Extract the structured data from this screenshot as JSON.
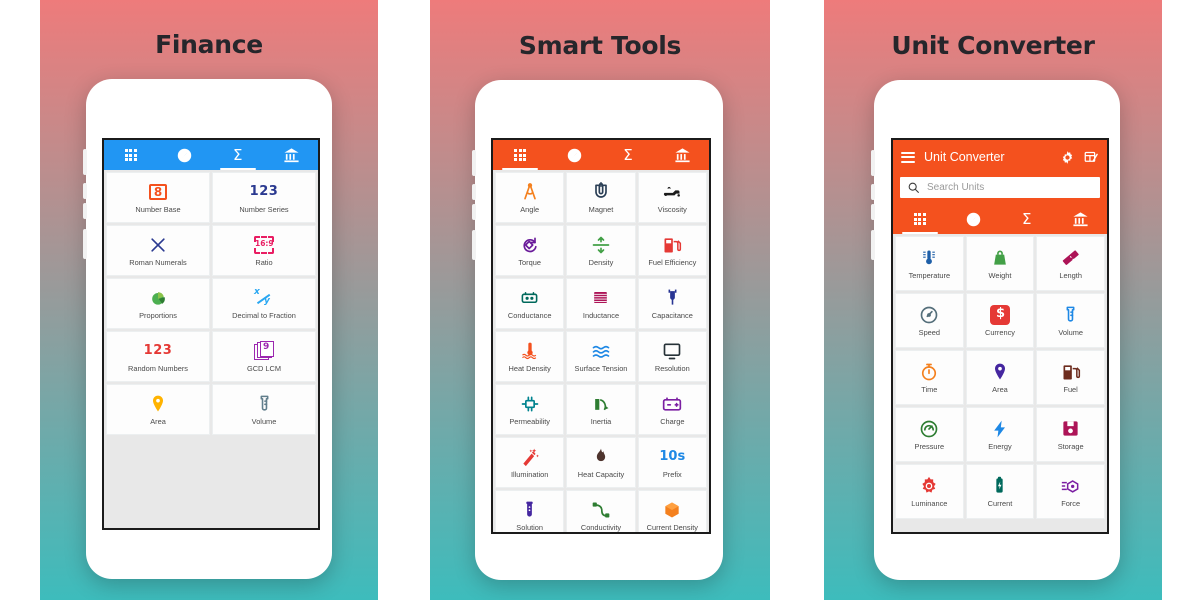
{
  "panels": [
    {
      "id": "finance",
      "title": "Finance",
      "accent": "#2196f3",
      "gradient_top": "#ee7b7b",
      "gradient_bottom": "#3dbcbc",
      "has_appbar": false,
      "has_search": false,
      "tabs": [
        {
          "icon": "grid-icon",
          "active": false
        },
        {
          "icon": "compass-icon",
          "active": false
        },
        {
          "icon": "sigma-icon",
          "active": true
        },
        {
          "icon": "bank-icon",
          "active": false
        }
      ],
      "grid_columns": 2,
      "items": [
        {
          "label": "Number Base",
          "icon": "number-base-icon",
          "color": "#f4511e"
        },
        {
          "label": "Number Series",
          "icon": "number-series-icon",
          "color": "#2a3990"
        },
        {
          "label": "Roman Numerals",
          "icon": "roman-numerals-icon",
          "color": "#2a3990"
        },
        {
          "label": "Ratio",
          "icon": "ratio-icon",
          "color": "#e91e63"
        },
        {
          "label": "Proportions",
          "icon": "proportions-icon",
          "color": "#4caf50"
        },
        {
          "label": "Decimal to Fraction",
          "icon": "decimal-fraction-icon",
          "color": "#29a7f2"
        },
        {
          "label": "Random Numbers",
          "icon": "random-numbers-icon",
          "color": "#e53935"
        },
        {
          "label": "GCD LCM",
          "icon": "gcd-lcm-icon",
          "color": "#9c27b0"
        },
        {
          "label": "Area",
          "icon": "area-pin-icon",
          "color": "#ffb300"
        },
        {
          "label": "Volume",
          "icon": "volume-beaker-icon",
          "color": "#607d8b"
        }
      ]
    },
    {
      "id": "smart-tools",
      "title": "Smart Tools",
      "accent": "#f4511e",
      "gradient_top": "#ee7b7b",
      "gradient_bottom": "#3dbcbc",
      "has_appbar": false,
      "has_search": false,
      "tabs": [
        {
          "icon": "grid-icon",
          "active": true
        },
        {
          "icon": "compass-icon",
          "active": false
        },
        {
          "icon": "sigma-icon",
          "active": false
        },
        {
          "icon": "bank-icon",
          "active": false
        }
      ],
      "grid_columns": 3,
      "items": [
        {
          "label": "Angle",
          "icon": "angle-compass-icon",
          "color": "#f4801e"
        },
        {
          "label": "Magnet",
          "icon": "magnet-icon",
          "color": "#2a3e55"
        },
        {
          "label": "Viscosity",
          "icon": "viscosity-icon",
          "color": "#1b1b1b"
        },
        {
          "label": "Torque",
          "icon": "torque-icon",
          "color": "#6a1b9a"
        },
        {
          "label": "Density",
          "icon": "density-icon",
          "color": "#43a047"
        },
        {
          "label": "Fuel Efficiency",
          "icon": "fuel-pump-icon",
          "color": "#e53935"
        },
        {
          "label": "Conductance",
          "icon": "conductance-icon",
          "color": "#00695c"
        },
        {
          "label": "Inductance",
          "icon": "inductance-icon",
          "color": "#ad1457"
        },
        {
          "label": "Capacitance",
          "icon": "capacitance-icon",
          "color": "#283593"
        },
        {
          "label": "Heat Density",
          "icon": "heat-density-icon",
          "color": "#f4511e"
        },
        {
          "label": "Surface Tension",
          "icon": "surface-tension-icon",
          "color": "#1e88e5"
        },
        {
          "label": "Resolution",
          "icon": "resolution-monitor-icon",
          "color": "#263238"
        },
        {
          "label": "Permeability",
          "icon": "permeability-icon",
          "color": "#00838f"
        },
        {
          "label": "Inertia",
          "icon": "inertia-icon",
          "color": "#2e7d32"
        },
        {
          "label": "Charge",
          "icon": "charge-battery-icon",
          "color": "#7b1fa2"
        },
        {
          "label": "Illumination",
          "icon": "illumination-icon",
          "color": "#e53935"
        },
        {
          "label": "Heat Capacity",
          "icon": "flame-icon",
          "color": "#4e342e"
        },
        {
          "label": "Prefix",
          "icon": "prefix-icon",
          "color": "#1e88e5",
          "text": "10s"
        },
        {
          "label": "Solution",
          "icon": "solution-tube-icon",
          "color": "#4527a0"
        },
        {
          "label": "Conductivity",
          "icon": "conductivity-icon",
          "color": "#2e7d32"
        },
        {
          "label": "Current Density",
          "icon": "current-density-icon",
          "color": "#f4801e"
        }
      ]
    },
    {
      "id": "unit-converter",
      "title": "Unit Converter",
      "accent": "#f4511e",
      "gradient_top": "#ee7b7b",
      "gradient_bottom": "#3dbcbc",
      "has_appbar": true,
      "has_search": true,
      "appbar": {
        "menu_icon": "hamburger-icon",
        "title": "Unit Converter",
        "actions": [
          {
            "icon": "gear-icon"
          },
          {
            "icon": "edit-table-icon"
          }
        ]
      },
      "search": {
        "icon": "search-icon",
        "placeholder": "Search Units",
        "value": ""
      },
      "tabs": [
        {
          "icon": "grid-icon",
          "active": true
        },
        {
          "icon": "compass-icon",
          "active": false
        },
        {
          "icon": "sigma-icon",
          "active": false
        },
        {
          "icon": "bank-icon",
          "active": false
        }
      ],
      "grid_columns": 3,
      "items": [
        {
          "label": "Temperature",
          "icon": "thermometer-icon",
          "color": "#1e5fa8"
        },
        {
          "label": "Weight",
          "icon": "weight-icon",
          "color": "#43a047"
        },
        {
          "label": "Length",
          "icon": "ruler-icon",
          "color": "#ad1457"
        },
        {
          "label": "Speed",
          "icon": "speedometer-icon",
          "color": "#546e7a"
        },
        {
          "label": "Currency",
          "icon": "currency-dollar-icon",
          "color": "#e53935"
        },
        {
          "label": "Volume",
          "icon": "volume-beaker-icon",
          "color": "#1e88e5"
        },
        {
          "label": "Time",
          "icon": "stopwatch-icon",
          "color": "#f4801e"
        },
        {
          "label": "Area",
          "icon": "area-pin-icon",
          "color": "#4527a0"
        },
        {
          "label": "Fuel",
          "icon": "fuel-pump-icon",
          "color": "#6d2c1e"
        },
        {
          "label": "Pressure",
          "icon": "pressure-gauge-icon",
          "color": "#2e7d32"
        },
        {
          "label": "Energy",
          "icon": "energy-bolt-icon",
          "color": "#1e88e5"
        },
        {
          "label": "Storage",
          "icon": "storage-disk-icon",
          "color": "#ad1457"
        },
        {
          "label": "Luminance",
          "icon": "luminance-icon",
          "color": "#e53935"
        },
        {
          "label": "Current",
          "icon": "current-battery-icon",
          "color": "#00695c"
        },
        {
          "label": "Force",
          "icon": "force-icon",
          "color": "#7b1fa2"
        }
      ]
    }
  ]
}
